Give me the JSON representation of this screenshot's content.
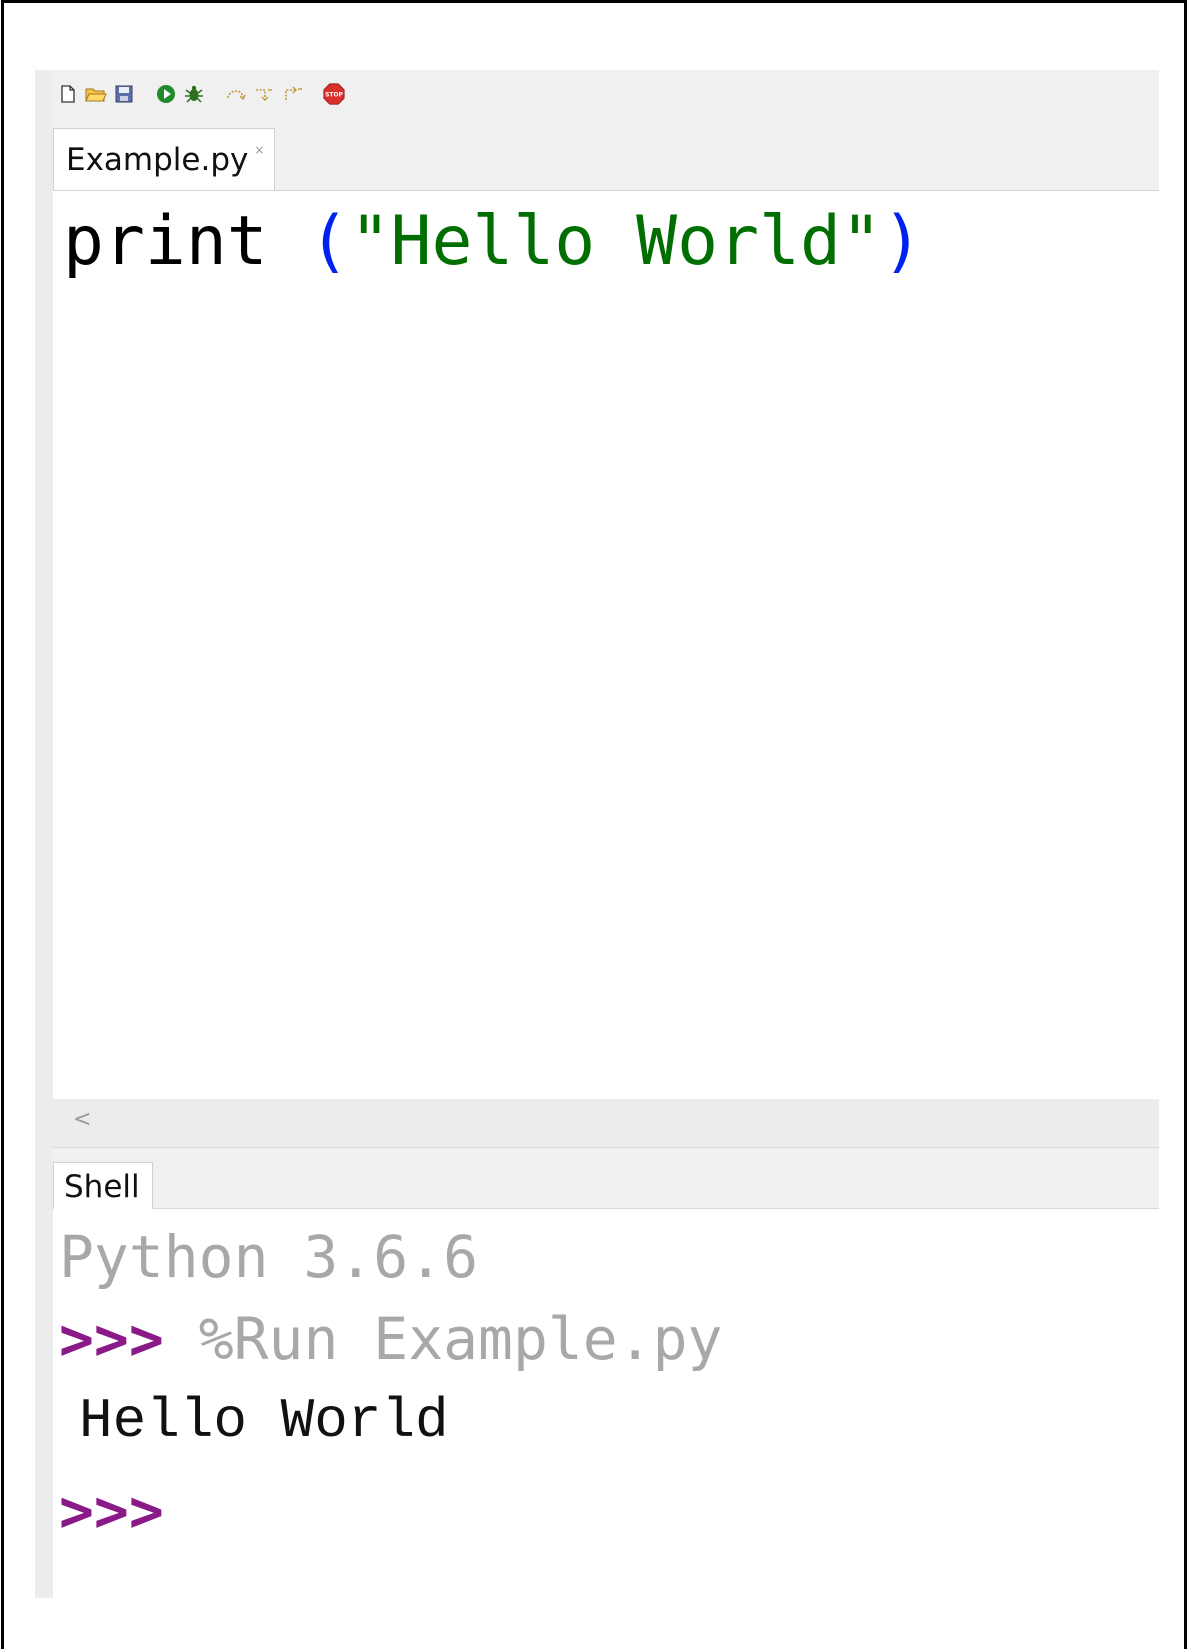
{
  "toolbar": {
    "buttons": [
      {
        "name": "new-file-icon"
      },
      {
        "name": "open-folder-icon"
      },
      {
        "name": "save-icon"
      },
      {
        "name": "run-icon"
      },
      {
        "name": "debug-icon"
      },
      {
        "name": "step-over-icon"
      },
      {
        "name": "step-into-icon"
      },
      {
        "name": "step-out-icon"
      },
      {
        "name": "stop-icon",
        "label": "STOP"
      }
    ]
  },
  "editor": {
    "tab": {
      "label": "Example.py",
      "close": "×"
    },
    "code": {
      "keyword": "print",
      "open_paren": "(",
      "string": "\"Hello World\"",
      "close_paren": ")"
    },
    "scroll_left": "<"
  },
  "shell": {
    "tab_label": "Shell",
    "version_line": "Python 3.6.6",
    "prompt": ">>>",
    "command": "%Run Example.py",
    "output": "Hello World",
    "final_prompt": ">>>"
  },
  "colors": {
    "keyword": "#000000",
    "paren": "#0022ee",
    "string": "#006e00",
    "prompt": "#8b1a89",
    "muted": "#a8a8a8",
    "stop": "#d9302c"
  }
}
